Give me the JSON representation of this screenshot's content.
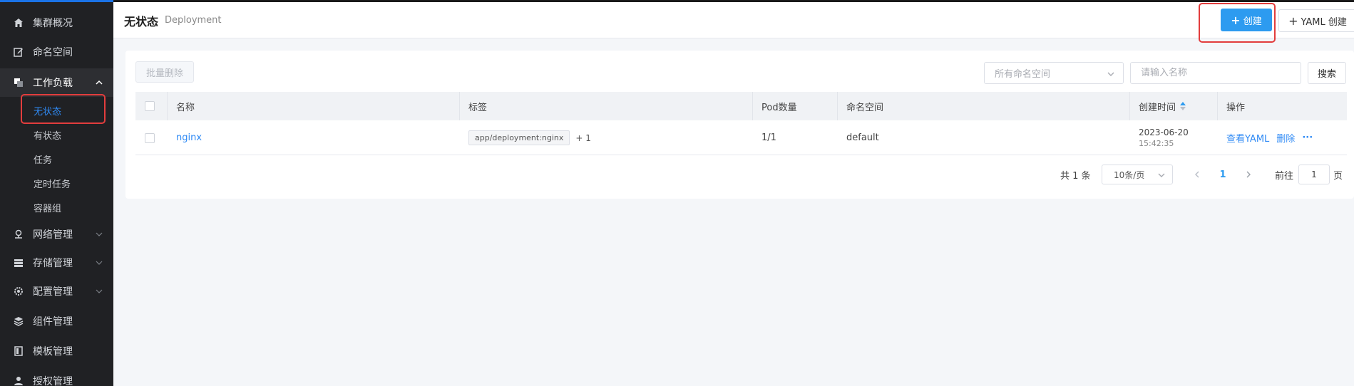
{
  "sidebar": {
    "items": [
      {
        "label": "集群概况",
        "icon": "home-icon"
      },
      {
        "label": "命名空间",
        "icon": "edit-icon"
      },
      {
        "label": "工作负载",
        "icon": "layers-icon",
        "expanded": true,
        "children": [
          {
            "label": "无状态",
            "active": true
          },
          {
            "label": "有状态"
          },
          {
            "label": "任务"
          },
          {
            "label": "定时任务"
          },
          {
            "label": "容器组"
          }
        ]
      },
      {
        "label": "网络管理",
        "icon": "network-icon"
      },
      {
        "label": "存储管理",
        "icon": "storage-icon"
      },
      {
        "label": "配置管理",
        "icon": "gear-icon"
      },
      {
        "label": "组件管理",
        "icon": "stack-icon"
      },
      {
        "label": "模板管理",
        "icon": "template-icon"
      },
      {
        "label": "授权管理",
        "icon": "user-icon"
      }
    ]
  },
  "header": {
    "title": "无状态",
    "subtitle": "Deployment",
    "create_label": "创建",
    "yaml_create_label": "YAML 创建"
  },
  "toolbar": {
    "batch_delete_label": "批量删除",
    "namespace_placeholder": "所有命名空间",
    "name_placeholder": "请输入名称",
    "search_label": "搜索"
  },
  "table": {
    "columns": [
      "名称",
      "标签",
      "Pod数量",
      "命名空间",
      "创建时间",
      "操作"
    ],
    "rows": [
      {
        "name": "nginx",
        "label_tag": "app/deployment:nginx",
        "label_more": "+ 1",
        "pods": "1/1",
        "namespace": "default",
        "created_date": "2023-06-20",
        "created_time": "15:42:35",
        "actions": {
          "view_yaml": "查看YAML",
          "delete": "删除",
          "more": "···"
        }
      }
    ]
  },
  "pagination": {
    "total_label": "共 1 条",
    "page_size": "10条/页",
    "current_page": "1",
    "goto_label": "前往",
    "goto_value": "1",
    "page_unit": "页"
  },
  "colors": {
    "accent": "#2d9bf0",
    "sidebar_bg": "#202124",
    "highlight_red": "#e23d3d"
  }
}
